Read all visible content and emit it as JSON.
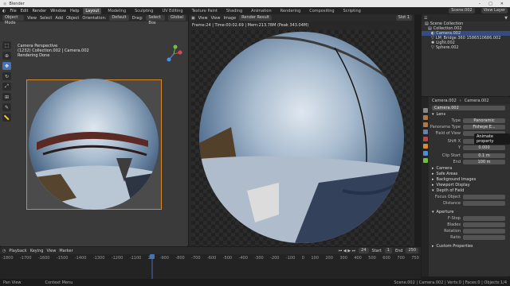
{
  "app": {
    "title": "Blender"
  },
  "menu": {
    "items": [
      "File",
      "Edit",
      "Render",
      "Window",
      "Help"
    ],
    "tabs": [
      "Layout",
      "Modeling",
      "Sculpting",
      "UV Editing",
      "Texture Paint",
      "Shading",
      "Animation",
      "Rendering",
      "Compositing",
      "Scripting"
    ],
    "active_tab": "Layout",
    "scene": "Scene.002",
    "view_layer": "View Layer"
  },
  "viewport": {
    "mode": "Object Mode",
    "menus": [
      "View",
      "Select",
      "Add",
      "Object"
    ],
    "orientation": "Orientation:",
    "orientation_value": "Default",
    "drag_label": "Drag:",
    "drag_value": "Select Box",
    "transform": "Global",
    "info": {
      "line1": "Camera Perspective",
      "line2": "(1232) Collection.002 | Camera.002",
      "line3": "Rendering Done"
    }
  },
  "render_view": {
    "menus": [
      "View",
      "View",
      "Image"
    ],
    "image_name": "Render Result",
    "slot": "Slot 1",
    "info": "Frame:24 | Time:00:02.69 | Mem:213.78M (Peak 343.04M)"
  },
  "outliner": {
    "title": "Scene Collection",
    "rows": [
      {
        "label": "Scene Collection",
        "indent": 0,
        "selected": false
      },
      {
        "label": "Collection.002",
        "indent": 1,
        "selected": false
      },
      {
        "label": "Camera.002",
        "indent": 2,
        "selected": true
      },
      {
        "label": "LM_Bridge 360 1586510686.002",
        "indent": 2,
        "selected": false
      },
      {
        "label": "Light.002",
        "indent": 2,
        "selected": false
      },
      {
        "label": "Sphere.002",
        "indent": 2,
        "selected": false
      }
    ]
  },
  "properties": {
    "breadcrumb": [
      "Camera.002",
      "Camera.002"
    ],
    "data_name": "Camera.002",
    "lens_section": "Lens",
    "type_label": "Type",
    "type_value": "Panoramic",
    "panorama_label": "Panorama Type",
    "panorama_value": "Fisheye E...",
    "fov_label": "Field of View",
    "shift_x_label": "Shift X",
    "shift_x_value": "0.000",
    "shift_y_label": "Y",
    "shift_y_value": "0.000",
    "clip_start_label": "Clip Start",
    "clip_start_value": "0.1 m",
    "clip_end_label": "End",
    "clip_end_value": "100 m",
    "sections": [
      "Camera",
      "Safe Areas",
      "Background Images",
      "Viewport Display",
      "Depth of Field"
    ],
    "focus_object_label": "Focus Object",
    "focus_distance_label": "Distance",
    "aperture_section": "Aperture",
    "aperture_rows": [
      "F-Stop",
      "Blades",
      "Rotation",
      "Ratio"
    ],
    "custom_props": "Custom Properties",
    "tooltip": "Animate property"
  },
  "timeline": {
    "menus": [
      "Playback",
      "Keying",
      "View",
      "Marker"
    ],
    "current_frame": "24",
    "start_label": "Start",
    "start_value": "1",
    "end_label": "End",
    "end_value": "250",
    "ruler": [
      "-1800",
      "-1700",
      "-1600",
      "-1500",
      "-1400",
      "-1300",
      "-1200",
      "-1100",
      "24",
      "-900",
      "-800",
      "-700",
      "-600",
      "-500",
      "-400",
      "-300",
      "-200",
      "-100",
      "0",
      "100",
      "200",
      "300",
      "400",
      "500",
      "600",
      "700",
      "750"
    ]
  },
  "status": {
    "left": "Pan View",
    "middle": "Context Menu",
    "right": "Scene.002 | Camera.002 | Verts:0 | Faces:0 | Objects:1/4"
  },
  "colors": {
    "accent": "#4772b3",
    "camera_frame": "#d8882a"
  }
}
